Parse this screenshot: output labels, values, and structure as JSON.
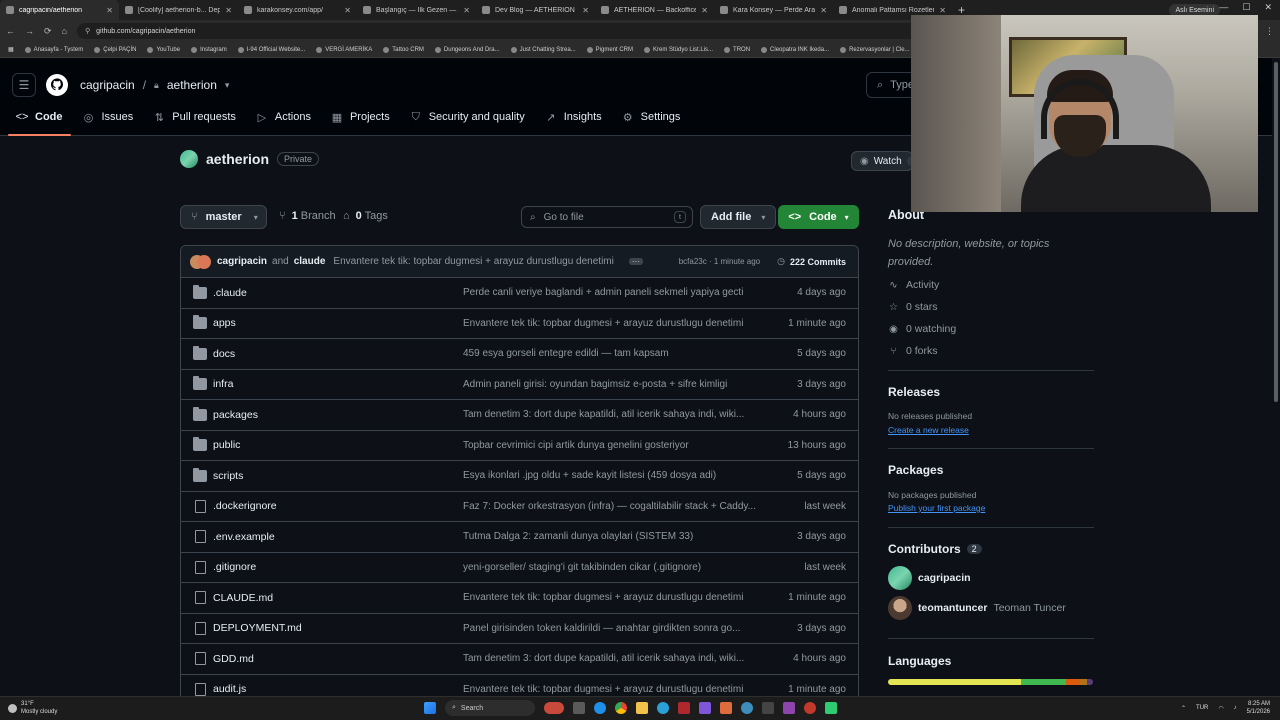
{
  "browser": {
    "tabs": [
      {
        "title": "cagripacin/aetherion",
        "active": true
      },
      {
        "title": "[Coolify] aetherion-b... Deploy"
      },
      {
        "title": "karakonsey.com/app/"
      },
      {
        "title": "Başlangıç — İlk Gezen — AETH..."
      },
      {
        "title": "Dev Blog — AETHERION"
      },
      {
        "title": "AETHERION — Backoffice"
      },
      {
        "title": "Kara Konsey — Perde Arabirimi"
      },
      {
        "title": "Anomali Pattamsı Rozetleri Sl..."
      }
    ],
    "profile": "Aslı Esemini",
    "url": "github.com/cagripacin/aetherion",
    "bookmarks": [
      "Anasayfa - Tystem",
      "Çelpi PAÇİN",
      "YouTube",
      "Instagram",
      "I-94 Official Website...",
      "VERGİ AMERİKA",
      "Tattoo CRM",
      "Dungeons And Dra...",
      "Just Chatting Strea...",
      "Pigment CRM",
      "Krem Stüdyo List.Lis...",
      "TRON",
      "Cleopatra INK Ikeda...",
      "Rezervasyonlar | Cle..."
    ]
  },
  "header": {
    "owner": "cagripacin",
    "repo": "aetherion",
    "search_placeholder": "Type"
  },
  "repo_nav": [
    {
      "label": "Code",
      "icon": "code-icon",
      "active": true
    },
    {
      "label": "Issues",
      "icon": "issue-icon"
    },
    {
      "label": "Pull requests",
      "icon": "pull-request-icon"
    },
    {
      "label": "Actions",
      "icon": "actions-icon"
    },
    {
      "label": "Projects",
      "icon": "projects-icon"
    },
    {
      "label": "Security and quality",
      "icon": "shield-icon"
    },
    {
      "label": "Insights",
      "icon": "graph-icon"
    },
    {
      "label": "Settings",
      "icon": "gear-icon"
    }
  ],
  "repo": {
    "name": "aetherion",
    "visibility": "Private",
    "watch_label": "Watch",
    "watch_count": "0"
  },
  "toolbar": {
    "branch": "master",
    "branch_count": "1",
    "branch_label": "Branch",
    "tag_count": "0",
    "tag_label": "Tags",
    "goto_placeholder": "Go to file",
    "goto_key": "t",
    "add_file": "Add file",
    "code": "Code"
  },
  "latest_commit": {
    "author1": "cagripacin",
    "conj": "and",
    "author2": "claude",
    "message": "Envantere tek tik: topbar dugmesi + arayuz durustlugu denetimi",
    "hash_time": "bcfa23c · 1 minute ago",
    "commits": "222 Commits"
  },
  "files": [
    {
      "type": "dir",
      "name": ".claude",
      "message": "Perde canli veriye baglandi + admin paneli sekmeli yapiya gecti",
      "date": "4 days ago"
    },
    {
      "type": "dir",
      "name": "apps",
      "message": "Envantere tek tik: topbar dugmesi + arayuz durustlugu denetimi",
      "date": "1 minute ago"
    },
    {
      "type": "dir",
      "name": "docs",
      "message": "459 esya gorseli entegre edildi — tam kapsam",
      "date": "5 days ago"
    },
    {
      "type": "dir",
      "name": "infra",
      "message": "Admin paneli girisi: oyundan bagimsiz e-posta + sifre kimligi",
      "date": "3 days ago"
    },
    {
      "type": "dir",
      "name": "packages",
      "message": "Tam denetim 3: dort dupe kapatildi, atil icerik sahaya indi, wiki...",
      "date": "4 hours ago"
    },
    {
      "type": "dir",
      "name": "public",
      "message": "Topbar cevrimici cipi artik dunya genelini gosteriyor",
      "date": "13 hours ago"
    },
    {
      "type": "dir",
      "name": "scripts",
      "message": "Esya ikonlari .jpg oldu + sade kayit listesi (459 dosya adi)",
      "date": "5 days ago"
    },
    {
      "type": "file",
      "name": ".dockerignore",
      "message": "Faz 7: Docker orkestrasyon (infra) — cogaltilabilir stack + Caddy...",
      "date": "last week"
    },
    {
      "type": "file",
      "name": ".env.example",
      "message": "Tutma Dalga 2: zamanli dunya olaylari (SISTEM 33)",
      "date": "3 days ago"
    },
    {
      "type": "file",
      "name": ".gitignore",
      "message": "yeni-gorseller/ staging'i git takibinden cikar (.gitignore)",
      "date": "last week"
    },
    {
      "type": "file",
      "name": "CLAUDE.md",
      "message": "Envantere tek tik: topbar dugmesi + arayuz durustlugu denetimi",
      "date": "1 minute ago"
    },
    {
      "type": "file",
      "name": "DEPLOYMENT.md",
      "message": "Panel girisinden token kaldirildi — anahtar girdikten sonra go...",
      "date": "3 days ago"
    },
    {
      "type": "file",
      "name": "GDD.md",
      "message": "Tam denetim 3: dort dupe kapatildi, atil icerik sahaya indi, wiki...",
      "date": "4 hours ago"
    },
    {
      "type": "file",
      "name": "audit.js",
      "message": "Envantere tek tik: topbar dugmesi + arayuz durustlugu denetimi",
      "date": "1 minute ago"
    }
  ],
  "sidebar": {
    "about_title": "About",
    "about_desc": "No description, website, or topics provided.",
    "stats": [
      {
        "icon": "pulse-icon",
        "label": "Activity"
      },
      {
        "icon": "star-icon",
        "label": "0 stars"
      },
      {
        "icon": "eye-icon",
        "label": "0 watching"
      },
      {
        "icon": "fork-icon",
        "label": "0 forks"
      }
    ],
    "releases_title": "Releases",
    "releases_empty": "No releases published",
    "releases_link": "Create a new release",
    "packages_title": "Packages",
    "packages_empty": "No packages published",
    "packages_link": "Publish your first package",
    "contributors_title": "Contributors",
    "contributors_count": "2",
    "contributors": [
      {
        "login": "cagripacin",
        "fullname": ""
      },
      {
        "login": "teomantuncer",
        "fullname": "Teoman Tuncer"
      }
    ],
    "languages_title": "Languages",
    "language_colors": [
      "#e3e553",
      "#3fb950",
      "#da5b0b",
      "#b07219",
      "#563d7c"
    ],
    "language_shares": [
      0.65,
      0.22,
      0.06,
      0.04,
      0.03
    ]
  },
  "taskbar": {
    "weather_temp": "31°F",
    "weather_desc": "Mostly cloudy",
    "search": "Search",
    "lang": "TUR",
    "time": "8:25 AM",
    "date": "5/1/2026"
  },
  "colors": {
    "accent_tab": "#f78166",
    "code_button": "#238636",
    "link": "#4493f8"
  }
}
